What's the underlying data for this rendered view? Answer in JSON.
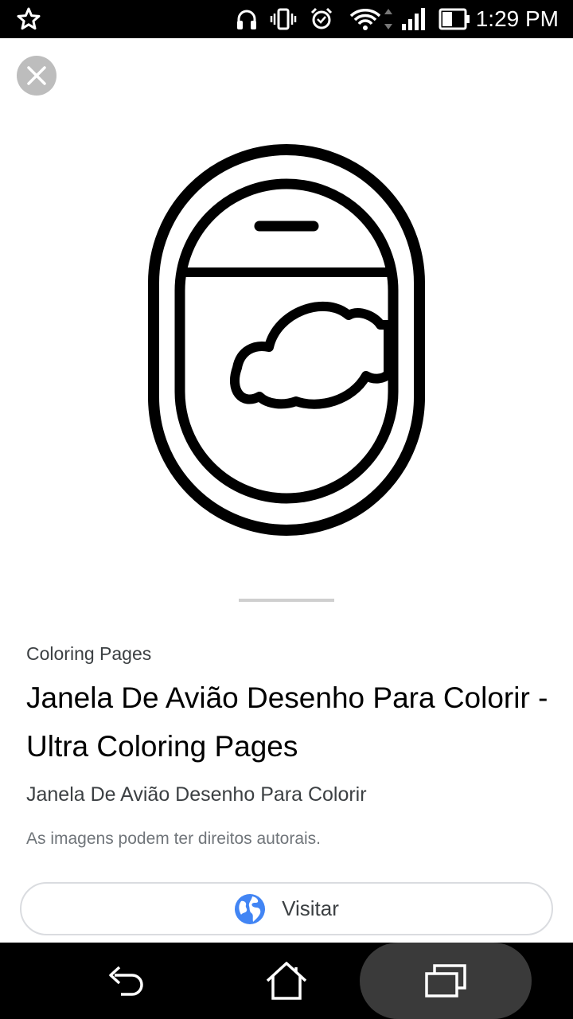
{
  "status_bar": {
    "time": "1:29 PM",
    "icons": [
      "star-icon",
      "headphones-icon",
      "vibrate-icon",
      "alarm-icon",
      "wifi-icon",
      "signal-icon",
      "battery-icon"
    ]
  },
  "result": {
    "source": "Coloring Pages",
    "title": "Janela De Avião Desenho Para Colorir - Ultra Coloring Pages",
    "subtitle": "Janela De Avião Desenho Para Colorir",
    "copyright_notice": "As imagens podem ter direitos autorais.",
    "visit_label": "Visitar"
  },
  "nav_bar": {
    "buttons": [
      "back-icon",
      "home-icon",
      "recent-apps-icon"
    ]
  },
  "colors": {
    "close_button_bg": "#bdbdbd",
    "globe_blue": "#4285f4",
    "status_bar_bg": "#000000",
    "recent_highlight": "#3a3a3a"
  }
}
